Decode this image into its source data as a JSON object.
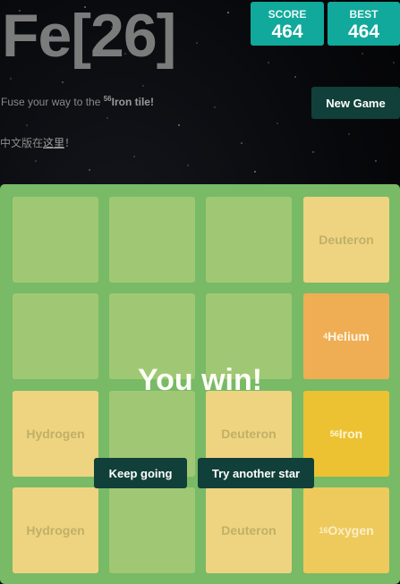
{
  "header": {
    "title": "Fe[26]",
    "score_label": "SCORE",
    "score_value": "464",
    "best_label": "BEST",
    "best_value": "464",
    "subtitle_prefix": "Fuse your way to the ",
    "subtitle_sup": "56",
    "subtitle_bold": "Iron tile!",
    "new_game_label": "New Game",
    "cn_prefix": "中文版在",
    "cn_link": "这里",
    "cn_suffix": "！"
  },
  "board": {
    "tiles": [
      {
        "id": "deuteron-r0c3",
        "sup": "",
        "label": "Deuteron"
      },
      {
        "id": "helium-r1c3",
        "sup": "4",
        "label": "Helium"
      },
      {
        "id": "hydrogen-r2c0",
        "sup": "",
        "label": "Hydrogen"
      },
      {
        "id": "deuteron-r2c2",
        "sup": "",
        "label": "Deuteron"
      },
      {
        "id": "iron-r2c3",
        "sup": "56",
        "label": "Iron"
      },
      {
        "id": "hydrogen-r3c0",
        "sup": "",
        "label": "Hydrogen"
      },
      {
        "id": "deuteron-r3c2",
        "sup": "",
        "label": "Deuteron"
      },
      {
        "id": "oxygen-r3c3",
        "sup": "16",
        "label": "Oxygen"
      }
    ]
  },
  "overlay": {
    "message": "You win!",
    "keep_going_label": "Keep going",
    "try_another_label": "Try another star"
  },
  "colors": {
    "accent_teal": "#10a99b",
    "dark_button": "#113f39",
    "board_bg": "#78ba66",
    "empty_cell": "#a0c874"
  }
}
